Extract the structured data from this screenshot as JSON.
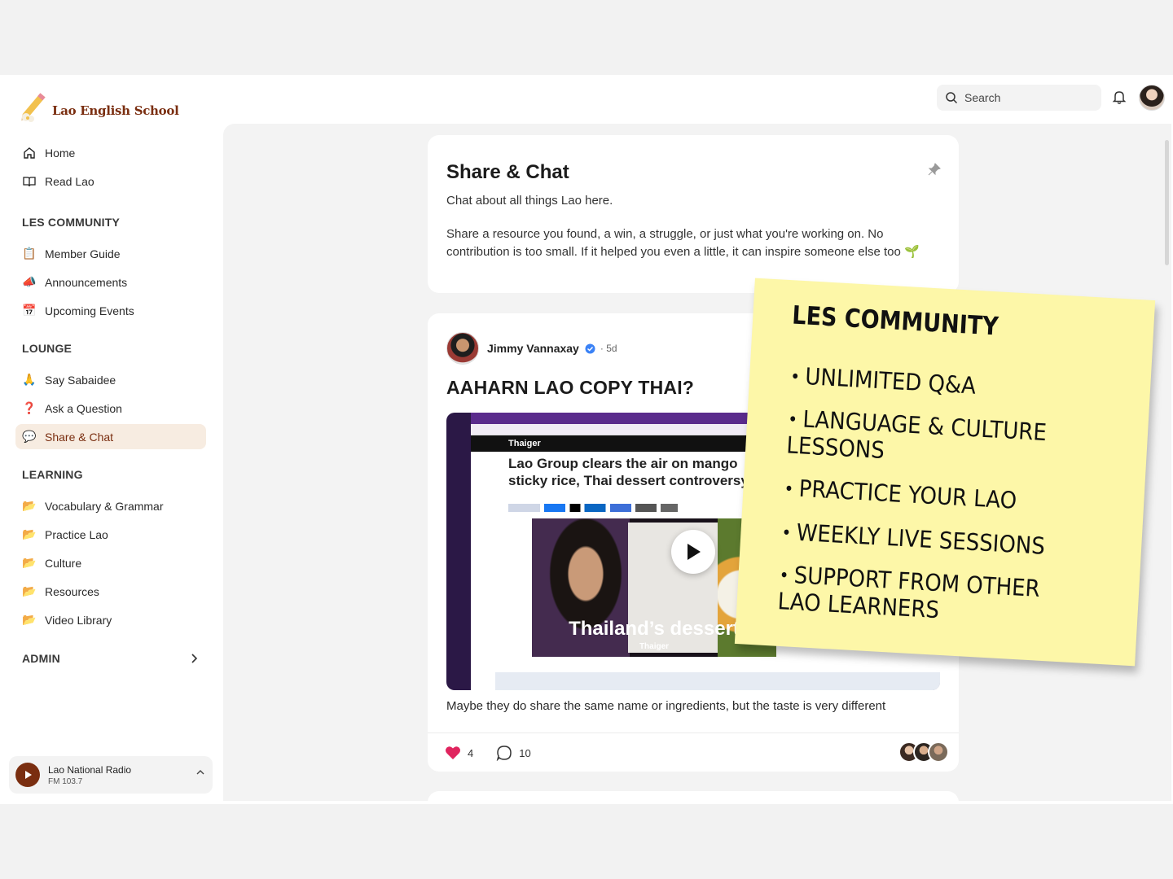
{
  "brand": {
    "name": "Lao English School"
  },
  "topbar": {
    "search_placeholder": "Search"
  },
  "sidebar": {
    "main": [
      {
        "label": "Home",
        "icon": "home-icon"
      },
      {
        "label": "Read Lao",
        "icon": "book-icon"
      }
    ],
    "sections": [
      {
        "title": "LES COMMUNITY",
        "items": [
          {
            "label": "Member Guide",
            "icon": "📋"
          },
          {
            "label": "Announcements",
            "icon": "📣"
          },
          {
            "label": "Upcoming Events",
            "icon": "📅"
          }
        ]
      },
      {
        "title": "LOUNGE",
        "items": [
          {
            "label": "Say Sabaidee",
            "icon": "🙏"
          },
          {
            "label": "Ask a Question",
            "icon": "❓"
          },
          {
            "label": "Share & Chat",
            "icon": "💬",
            "active": true
          }
        ]
      },
      {
        "title": "LEARNING",
        "items": [
          {
            "label": "Vocabulary & Grammar",
            "icon": "📂"
          },
          {
            "label": "Practice Lao",
            "icon": "📂"
          },
          {
            "label": "Culture",
            "icon": "📂"
          },
          {
            "label": "Resources",
            "icon": "📂"
          },
          {
            "label": "Video Library",
            "icon": "📂"
          }
        ]
      }
    ],
    "admin_label": "ADMIN",
    "radio": {
      "title": "Lao National Radio",
      "subtitle": "FM 103.7"
    }
  },
  "space": {
    "title": "Share & Chat",
    "description_1": "Chat about all things Lao here.",
    "description_2": "Share a resource you found, a win, a struggle, or just what you're working on. No contribution is too small. If it helped you even a little, it can inspire someone else too 🌱"
  },
  "post": {
    "author": "Jimmy Vannaxay",
    "time": "· 5d",
    "title": "AAHARN LAO COPY THAI?",
    "video": {
      "site": "Thaiger",
      "headline": "Lao Group clears the air on mango sticky rice, Thai dessert controversy",
      "caption": "Thailand’s dessert",
      "caption_logo": "Thaiger"
    },
    "body": "Maybe they do share the same name or ingredients, but the taste is very different",
    "likes": "4",
    "comments": "10"
  },
  "sticky_note": {
    "title": "LES COMMUNITY",
    "items": [
      "UNLIMITED Q&A",
      "LANGUAGE & CULTURE LESSONS",
      "PRACTICE YOUR LAO",
      "WEEKLY LIVE SESSIONS",
      "SUPPORT FROM OTHER LAO LEARNERS"
    ]
  },
  "colors": {
    "brand": "#7a2e10",
    "active_bg": "#f7ece1",
    "sticky": "#fdf7a8",
    "like": "#e0245e"
  }
}
